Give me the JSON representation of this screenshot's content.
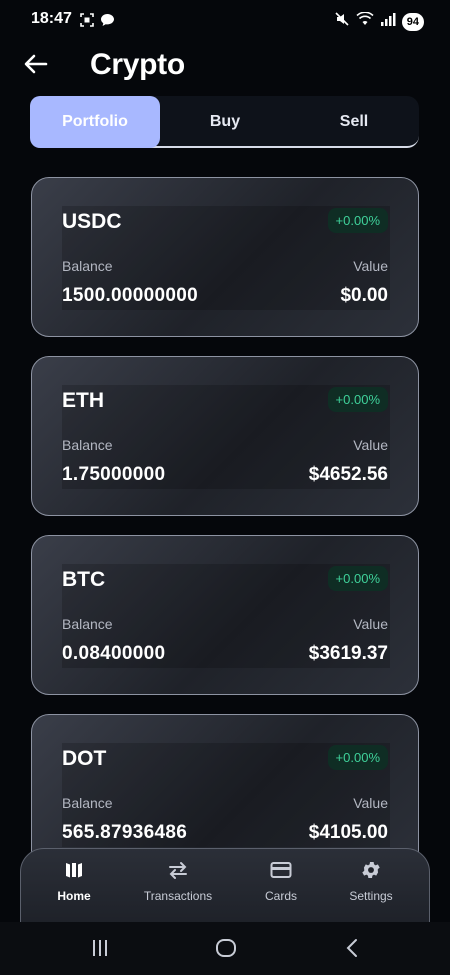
{
  "status_bar": {
    "time": "18:47",
    "battery": "94",
    "icons": [
      "screenshot-icon",
      "chat-bubble-icon",
      "mute-icon",
      "wifi-icon",
      "signal-icon"
    ]
  },
  "header": {
    "title": "Crypto",
    "back_icon": "arrow-left-icon"
  },
  "tabs": [
    {
      "label": "Portfolio",
      "active": true
    },
    {
      "label": "Buy",
      "active": false
    },
    {
      "label": "Sell",
      "active": false
    }
  ],
  "cards": [
    {
      "symbol": "USDC",
      "change": "+0.00%",
      "balance_label": "Balance",
      "value_label": "Value",
      "balance": "1500.00000000",
      "value": "$0.00"
    },
    {
      "symbol": "ETH",
      "change": "+0.00%",
      "balance_label": "Balance",
      "value_label": "Value",
      "balance": "1.75000000",
      "value": "$4652.56"
    },
    {
      "symbol": "BTC",
      "change": "+0.00%",
      "balance_label": "Balance",
      "value_label": "Value",
      "balance": "0.08400000",
      "value": "$3619.37"
    },
    {
      "symbol": "DOT",
      "change": "+0.00%",
      "balance_label": "Balance",
      "value_label": "Value",
      "balance": "565.87936486",
      "value": "$4105.00"
    }
  ],
  "bottom_nav": [
    {
      "label": "Home",
      "icon": "columns-icon",
      "active": true
    },
    {
      "label": "Transactions",
      "icon": "swap-arrows-icon",
      "active": false
    },
    {
      "label": "Cards",
      "icon": "credit-card-icon",
      "active": false
    },
    {
      "label": "Settings",
      "icon": "gear-icon",
      "active": false
    }
  ],
  "colors": {
    "accent": "#a8b8ff",
    "positive": "#3fd19a",
    "background": "#05070b"
  }
}
